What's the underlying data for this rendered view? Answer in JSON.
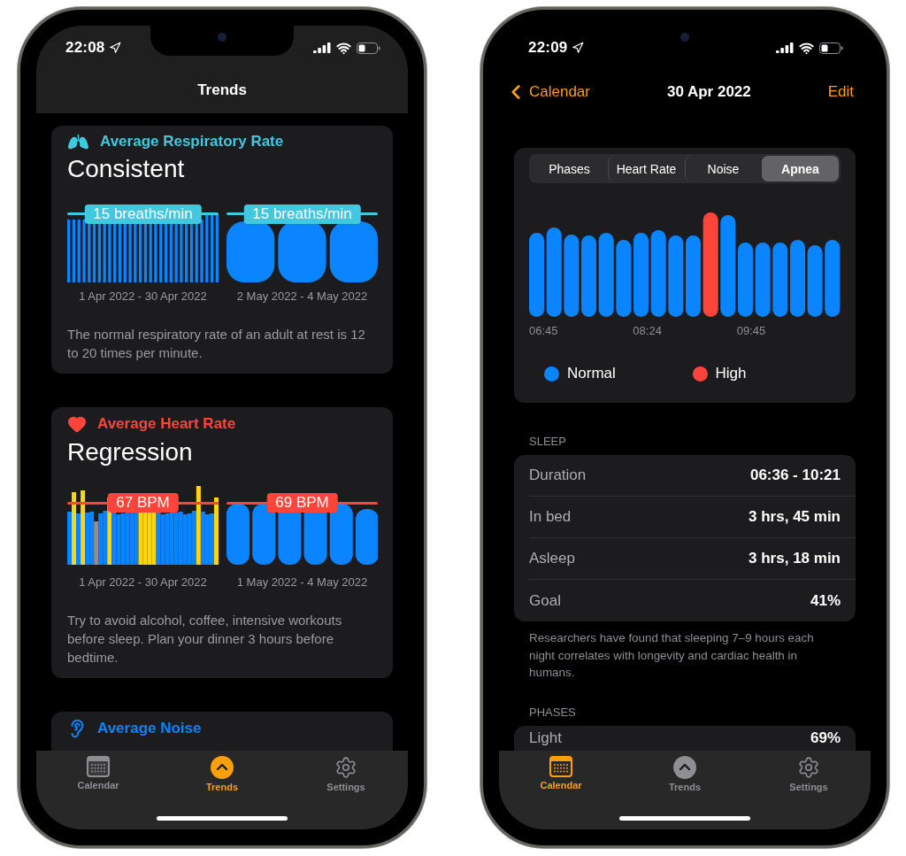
{
  "left_phone": {
    "status_bar": {
      "time": "22:08"
    },
    "nav": {
      "title": "Trends"
    },
    "cards": [
      {
        "kind": "respiratory",
        "color": "#40c8e0",
        "title": "Average Respiratory Rate",
        "headline": "Consistent",
        "charts": [
          {
            "badge": "15 breaths/min",
            "range": "1 Apr 2022 - 30 Apr 2022"
          },
          {
            "badge": "15 breaths/min",
            "range": "2 May 2022 - 4 May 2022"
          }
        ],
        "note": "The normal respiratory rate of an adult at rest is 12 to 20 times per minute."
      },
      {
        "kind": "heart",
        "color": "#ff453a",
        "title": "Average Heart Rate",
        "headline": "Regression",
        "charts": [
          {
            "badge": "67 BPM",
            "range": "1 Apr 2022 - 30 Apr 2022"
          },
          {
            "badge": "69 BPM",
            "range": "1 May 2022 - 4 May 2022"
          }
        ],
        "note": "Try to avoid alcohol, coffee, intensive workouts before sleep. Plan your dinner 3 hours before bedtime."
      },
      {
        "kind": "noise",
        "color": "#0a84ff",
        "title": "Average Noise"
      }
    ],
    "tab_bar": [
      {
        "label": "Calendar",
        "selected": false
      },
      {
        "label": "Trends",
        "selected": true
      },
      {
        "label": "Settings",
        "selected": false
      }
    ]
  },
  "right_phone": {
    "status_bar": {
      "time": "22:09"
    },
    "nav": {
      "back": "Calendar",
      "title": "30 Apr 2022",
      "action": "Edit"
    },
    "segments": [
      {
        "label": "Phases",
        "selected": false
      },
      {
        "label": "Heart Rate",
        "selected": false
      },
      {
        "label": "Noise",
        "selected": false
      },
      {
        "label": "Apnea",
        "selected": true
      }
    ],
    "chart": {
      "x_labels": [
        "06:45",
        "08:24",
        "09:45"
      ],
      "legend": [
        {
          "label": "Normal",
          "color": "#0a84ff"
        },
        {
          "label": "High",
          "color": "#ff453a"
        }
      ]
    },
    "sleep": {
      "header": "SLEEP",
      "rows": [
        {
          "label": "Duration",
          "value": "06:36 - 10:21"
        },
        {
          "label": "In bed",
          "value": "3 hrs, 45 min"
        },
        {
          "label": "Asleep",
          "value": "3 hrs, 18 min"
        },
        {
          "label": "Goal",
          "value": "41%"
        }
      ],
      "footnote": "Researchers have found that sleeping 7–9 hours each night correlates with longevity and cardiac health in humans."
    },
    "phases": {
      "header": "PHASES",
      "rows": [
        {
          "label": "Light",
          "value": "69%"
        }
      ]
    },
    "tab_bar": [
      {
        "label": "Calendar",
        "selected": true
      },
      {
        "label": "Trends",
        "selected": false
      },
      {
        "label": "Settings",
        "selected": false
      }
    ]
  }
}
